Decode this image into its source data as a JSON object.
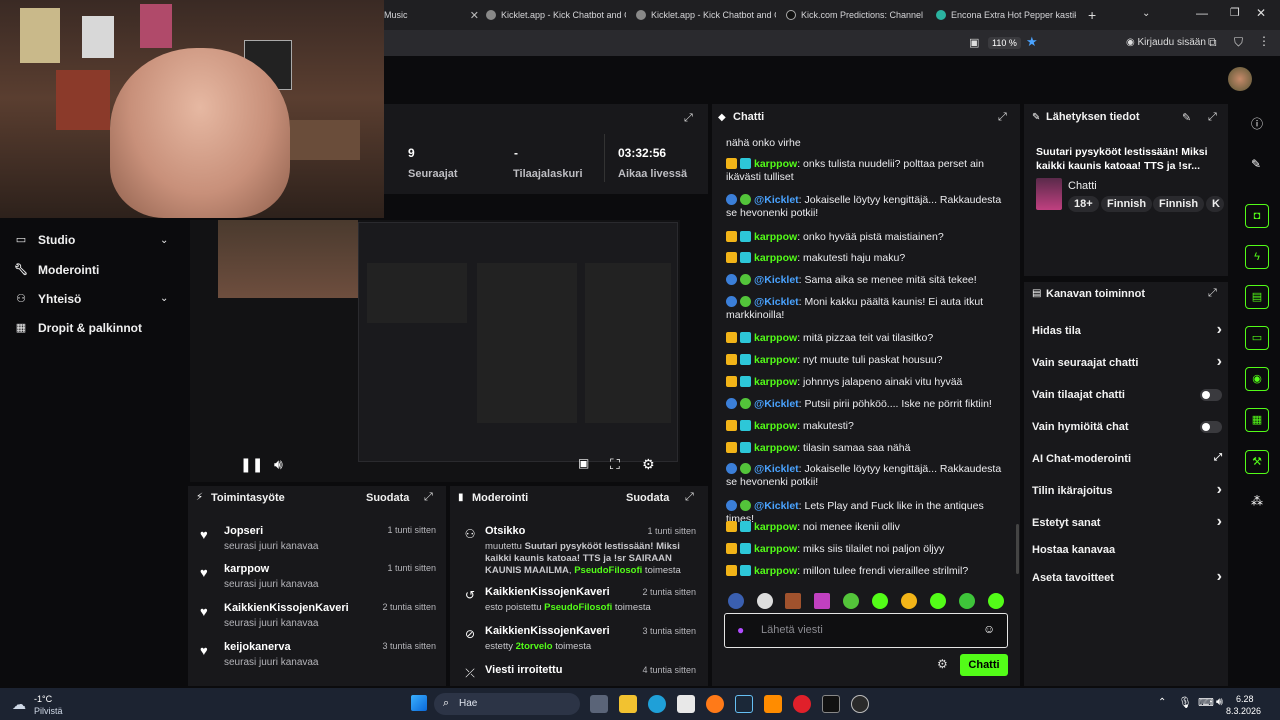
{
  "browser": {
    "tabs": [
      {
        "label": "Music"
      },
      {
        "label": "Kicklet.app - Kick Chatbot and C"
      },
      {
        "label": "Kicklet.app - Kick Chatbot and C"
      },
      {
        "label": "Kick.com Predictions: Channel P"
      },
      {
        "label": "Encona Extra Hot Pepper kastik"
      }
    ],
    "new_tab": "+",
    "zoom": "110 %",
    "login_label": "Kirjaudu sisään"
  },
  "stats": {
    "followers_value": "9",
    "followers_label": "Seuraajat",
    "subs_value": "-",
    "subs_label": "Tilaajalaskuri",
    "uptime_value": "03:32:56",
    "uptime_label": "Aikaa livessä"
  },
  "sidebar": {
    "items": [
      {
        "label": "Studio"
      },
      {
        "label": "Moderointi"
      },
      {
        "label": "Yhteisö"
      },
      {
        "label": "Dropit & palkinnot"
      }
    ]
  },
  "activity": {
    "title": "Toimintasyöte",
    "filter": "Suodata",
    "rows": [
      {
        "name": "Jopseri",
        "sub": "seurasi juuri kanavaa",
        "time": "1 tunti sitten"
      },
      {
        "name": "karppow",
        "sub": "seurasi juuri kanavaa",
        "time": "1 tunti sitten"
      },
      {
        "name": "KaikkienKissojenKaveri",
        "sub": "seurasi juuri kanavaa",
        "time": "2 tuntia sitten"
      },
      {
        "name": "keijokanerva",
        "sub": "seurasi juuri kanavaa",
        "time": "3 tuntia sitten"
      }
    ]
  },
  "moderation": {
    "title": "Moderointi",
    "filter": "Suodata",
    "rows": [
      {
        "name": "Otsikko",
        "time": "1 tunti sitten",
        "pre": "muutettu ",
        "bold": "Suutari pysykööt lestissään! Miksi kaikki kaunis katoaa! TTS ja !sr SAIRAAN KAUNIS MAAILMA",
        "sep": ", ",
        "user": "PseudoFilosofi",
        "post": " toimesta"
      },
      {
        "name": "KaikkienKissojenKaveri",
        "time": "2 tuntia sitten",
        "pre": "esto poistettu ",
        "user": "PseudoFilosofi",
        "post": " toimesta"
      },
      {
        "name": "KaikkienKissojenKaveri",
        "time": "3 tuntia sitten",
        "pre": "estetty ",
        "user": "2torvelo",
        "post": " toimesta"
      },
      {
        "name": "Viesti irroitettu",
        "time": "4 tuntia sitten"
      }
    ]
  },
  "chat": {
    "title": "Chatti",
    "top_fragment": "nähä onko virhe",
    "messages": [
      {
        "user": "karppow",
        "kind": "user",
        "text": ": onks tulista nuudelii? polttaa perset ain ikävästi tulliset"
      },
      {
        "user": "@Kicklet",
        "kind": "bot",
        "text": ": Jokaiselle löytyy kengittäjä... Rakkaudesta se hevonenki potkii!"
      },
      {
        "user": "karppow",
        "kind": "user",
        "text": ": onko hyvää pistä maistiainen?"
      },
      {
        "user": "karppow",
        "kind": "user",
        "text": ": makutesti haju maku?"
      },
      {
        "user": "@Kicklet",
        "kind": "bot",
        "text": ": Sama aika se menee mitä sitä tekee!"
      },
      {
        "user": "@Kicklet",
        "kind": "bot",
        "text": ": Moni kakku päältä kaunis! Ei auta itkut markkinoilla!"
      },
      {
        "user": "karppow",
        "kind": "user",
        "text": ": mitä pizzaa teit vai tilasitko?"
      },
      {
        "user": "karppow",
        "kind": "user",
        "text": ": nyt muute tuli paskat housuu?"
      },
      {
        "user": "karppow",
        "kind": "user",
        "text": ": johnnys jalapeno ainaki vitu hyvää"
      },
      {
        "user": "@Kicklet",
        "kind": "bot",
        "text": ": Putsii pirii pöhköö.... Iske ne pörrit fiktiin!"
      },
      {
        "user": "karppow",
        "kind": "user",
        "text": ": makutesti?"
      },
      {
        "user": "karppow",
        "kind": "user",
        "text": ": tilasin samaa saa nähä"
      },
      {
        "user": "@Kicklet",
        "kind": "bot",
        "text": ": Jokaiselle löytyy kengittäjä... Rakkaudesta se hevonenki potkii!"
      },
      {
        "user": "@Kicklet",
        "kind": "bot",
        "text": ": Lets Play and Fuck like in the antiques times!"
      },
      {
        "user": "karppow",
        "kind": "user",
        "text": ": noi menee ikenii olliv"
      },
      {
        "user": "karppow",
        "kind": "user",
        "text": ": miks siis tilailet noi paljon öljyy"
      },
      {
        "user": "karppow",
        "kind": "user",
        "text": ": millon tulee frendi vieraillee strilmil?"
      }
    ],
    "input_placeholder": "Lähetä viesti",
    "send_label": "Chatti"
  },
  "stream_info": {
    "title": "Lähetyksen tiedot",
    "stream_title": "Suutari pysykööt lestissään! Miksi kaikki kaunis katoaa! TTS ja !sr...",
    "category": "Chatti",
    "tags": [
      "18+",
      "Finnish",
      "Finnish",
      "K"
    ]
  },
  "channel_actions": {
    "title": "Kanavan toiminnot",
    "items": [
      {
        "label": "Hidas tila",
        "control": "chevron"
      },
      {
        "label": "Vain seuraajat chatti",
        "control": "chevron"
      },
      {
        "label": "Vain tilaajat chatti",
        "control": "toggle"
      },
      {
        "label": "Vain hymiöitä chat",
        "control": "toggle"
      },
      {
        "label": "AI Chat-moderointi",
        "control": "external"
      },
      {
        "label": "Tilin ikärajoitus",
        "control": "chevron"
      },
      {
        "label": "Estetyt sanat",
        "control": "chevron"
      },
      {
        "label": "Hostaa kanavaa",
        "control": "none"
      },
      {
        "label": "Aseta tavoitteet",
        "control": "chevron"
      }
    ]
  },
  "taskbar": {
    "weather_temp": "-1°C",
    "weather_desc": "Pilvistä",
    "search_label": "Hae",
    "time": "6.28",
    "date": "8.3.2026"
  },
  "colors": {
    "accent": "#53fc18",
    "panel": "#18181b",
    "bg": "#0b0b0d"
  }
}
